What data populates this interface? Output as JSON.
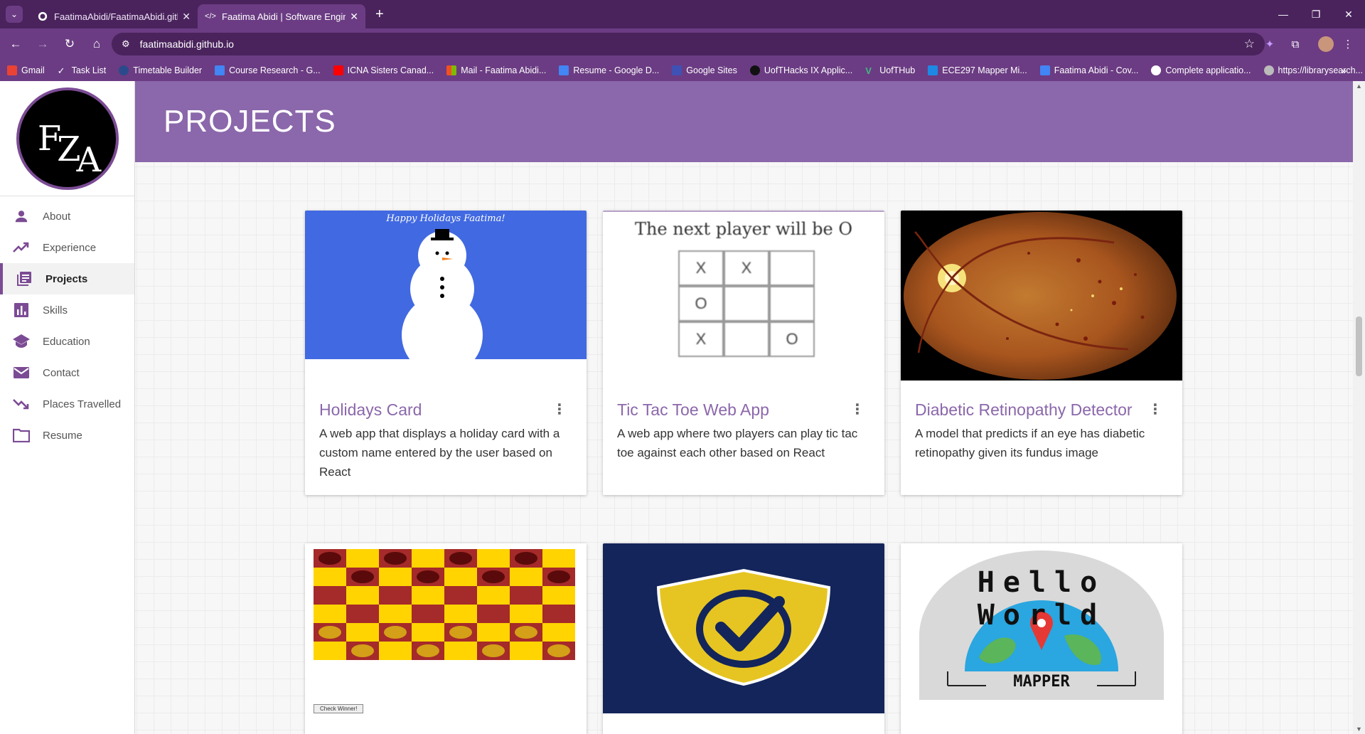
{
  "browser": {
    "tabs": [
      {
        "title": "FaatimaAbidi/FaatimaAbidi.githu"
      },
      {
        "title": "Faatima Abidi | Software Engine"
      }
    ],
    "url": "faatimaabidi.github.io",
    "bookmarks": [
      {
        "label": "Gmail",
        "color": "#ea4335"
      },
      {
        "label": "Task List",
        "color": "#ffffff"
      },
      {
        "label": "Timetable Builder",
        "color": "#2b4a8b"
      },
      {
        "label": "Course Research - G...",
        "color": "#4285f4"
      },
      {
        "label": "ICNA Sisters Canad...",
        "color": "#ff0000"
      },
      {
        "label": "Mail - Faatima Abidi...",
        "color": "#f25022"
      },
      {
        "label": "Resume - Google D...",
        "color": "#4285f4"
      },
      {
        "label": "Google Sites",
        "color": "#3f51b5"
      },
      {
        "label": "UofTHacks IX Applic...",
        "color": "#111111"
      },
      {
        "label": "UofTHub",
        "color": "#41b883"
      },
      {
        "label": "ECE297 Mapper Mi...",
        "color": "#1e88e5"
      },
      {
        "label": "Faatima Abidi - Cov...",
        "color": "#4285f4"
      },
      {
        "label": "Complete applicatio...",
        "color": "#ffffff"
      },
      {
        "label": "https://librarysearch...",
        "color": "#bbbbbb"
      }
    ]
  },
  "sidebar": {
    "logo_text": "FZA",
    "items": [
      {
        "label": "About",
        "icon": "person-icon"
      },
      {
        "label": "Experience",
        "icon": "trending-up-icon"
      },
      {
        "label": "Projects",
        "icon": "library-books-icon"
      },
      {
        "label": "Skills",
        "icon": "bar-chart-icon"
      },
      {
        "label": "Education",
        "icon": "school-icon"
      },
      {
        "label": "Contact",
        "icon": "mail-icon"
      },
      {
        "label": "Places Travelled",
        "icon": "trending-down-icon"
      },
      {
        "label": "Resume",
        "icon": "folder-icon"
      }
    ],
    "active": "Projects"
  },
  "banner": {
    "title": "PROJECTS"
  },
  "projects": [
    {
      "title": "Holidays Card",
      "description": "A web app that displays a holiday card with a custom name entered by the user based on React",
      "image_text": "Happy Holidays Faatima!"
    },
    {
      "title": "Tic Tac Toe Web App",
      "description": "A web app where two players can play tic tac toe against each other based on React",
      "image_text": "The next player will be O",
      "board": [
        "X",
        "X",
        "",
        "O",
        "",
        "",
        "X",
        "",
        "O"
      ]
    },
    {
      "title": "Diabetic Retinopathy Detector",
      "description": "A model that predicts if an eye has diabetic retinopathy given its fundus image"
    },
    {
      "image_text": "Check Winner!"
    },
    {},
    {
      "image_text": "Hello World",
      "image_subtext": "MAPPER"
    }
  ],
  "colors": {
    "accent": "#8b67ab",
    "chrome": "#6b3c83",
    "chrome_dark": "#4a235d"
  }
}
